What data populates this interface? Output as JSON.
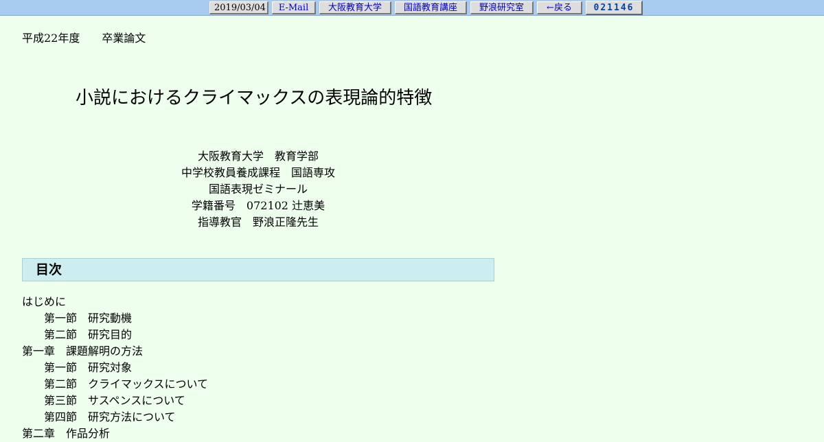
{
  "topbar": {
    "date": "2019/03/04",
    "email": "E-Mail",
    "university": "大阪教育大学",
    "department": "国語教育講座",
    "lab": "野浪研究室",
    "back": "←戻る",
    "counter": "021146"
  },
  "header": {
    "year_label": "平成22年度　　卒業論文"
  },
  "thesis": {
    "title": "小説におけるクライマックスの表現論的特徴",
    "affiliation": [
      "大阪教育大学　教育学部",
      "中学校教員養成課程　国語専攻",
      "国語表現ゼミナール",
      "学籍番号　072102 辻恵美",
      "指導教官　野浪正隆先生"
    ]
  },
  "toc": {
    "heading": "目次",
    "items": [
      {
        "label": "はじめに",
        "level": 1
      },
      {
        "label": "第一節　研究動機",
        "level": 2
      },
      {
        "label": "第二節　研究目的",
        "level": 2
      },
      {
        "label": "第一章　課題解明の方法",
        "level": 1
      },
      {
        "label": "第一節　研究対象",
        "level": 2
      },
      {
        "label": "第二節　クライマックスについて",
        "level": 2
      },
      {
        "label": "第三節　サスペンスについて",
        "level": 2
      },
      {
        "label": "第四節　研究方法について",
        "level": 2
      },
      {
        "label": "第二章　作品分析",
        "level": 1
      }
    ]
  }
}
